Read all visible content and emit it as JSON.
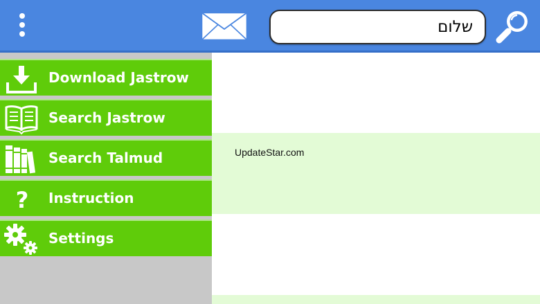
{
  "header": {
    "menu_icon": "more-vertical-icon",
    "mail_icon": "envelope-icon",
    "search": {
      "value": "שלום",
      "icon": "magnifier-icon"
    }
  },
  "sidebar": {
    "items": [
      {
        "label": "Download Jastrow",
        "icon": "download-icon"
      },
      {
        "label": "Search Jastrow",
        "icon": "open-book-icon"
      },
      {
        "label": "Search Talmud",
        "icon": "books-icon"
      },
      {
        "label": "Instruction",
        "icon": "question-icon"
      },
      {
        "label": "Settings",
        "icon": "gears-icon"
      }
    ]
  },
  "content": {
    "watermark": "UpdateStar.com"
  },
  "colors": {
    "header_blue": "#4a86e0",
    "menu_green": "#5fcc0a",
    "sidebar_gray": "#c8c8c8",
    "row_light_green": "#e3fbd6"
  }
}
